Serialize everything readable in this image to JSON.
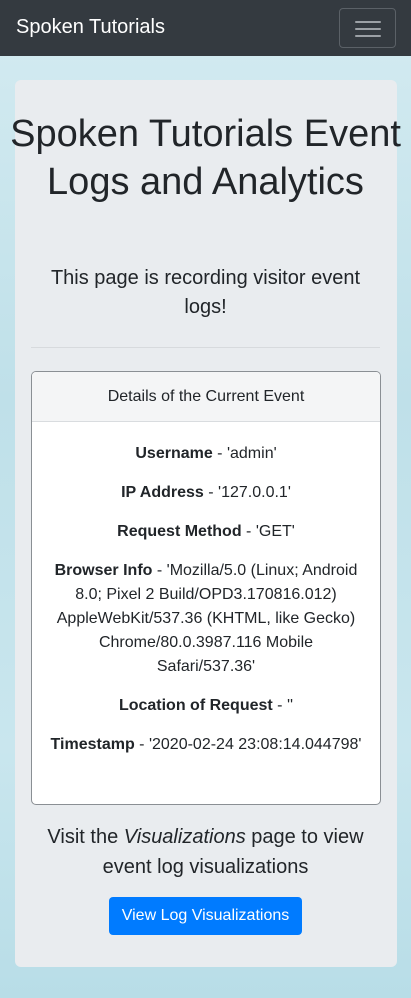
{
  "navbar": {
    "brand": "Spoken Tutorials",
    "toggler_icon": "hamburger-menu-icon"
  },
  "header": {
    "title": "Spoken Tutorials Event Logs and Analytics",
    "lead": "This page is recording visitor event logs!"
  },
  "card": {
    "header": "Details of the Current Event",
    "fields": [
      {
        "label": "Username",
        "value": " - 'admin'"
      },
      {
        "label": "IP Address",
        "value": " - '127.0.0.1'"
      },
      {
        "label": "Request Method",
        "value": " - 'GET'"
      },
      {
        "label": "Browser Info",
        "value": " - 'Mozilla/5.0 (Linux; Android 8.0; Pixel 2 Build/OPD3.170816.012) AppleWebKit/537.36 (KHTML, like Gecko) Chrome/80.0.3987.116 Mobile Safari/537.36'"
      },
      {
        "label": "Location of Request",
        "value": " - ''"
      },
      {
        "label": "Timestamp",
        "value": " - '2020-02-24 23:08:14.044798'"
      }
    ]
  },
  "visit": {
    "prefix": "Visit the ",
    "link_word": "Visualizations",
    "suffix": " page to view event log visualizations"
  },
  "button": {
    "label": "View Log Visualizations"
  },
  "colors": {
    "navbar": "#343a40",
    "jumbotron": "#e9ecef",
    "primary_button": "#007bff"
  }
}
